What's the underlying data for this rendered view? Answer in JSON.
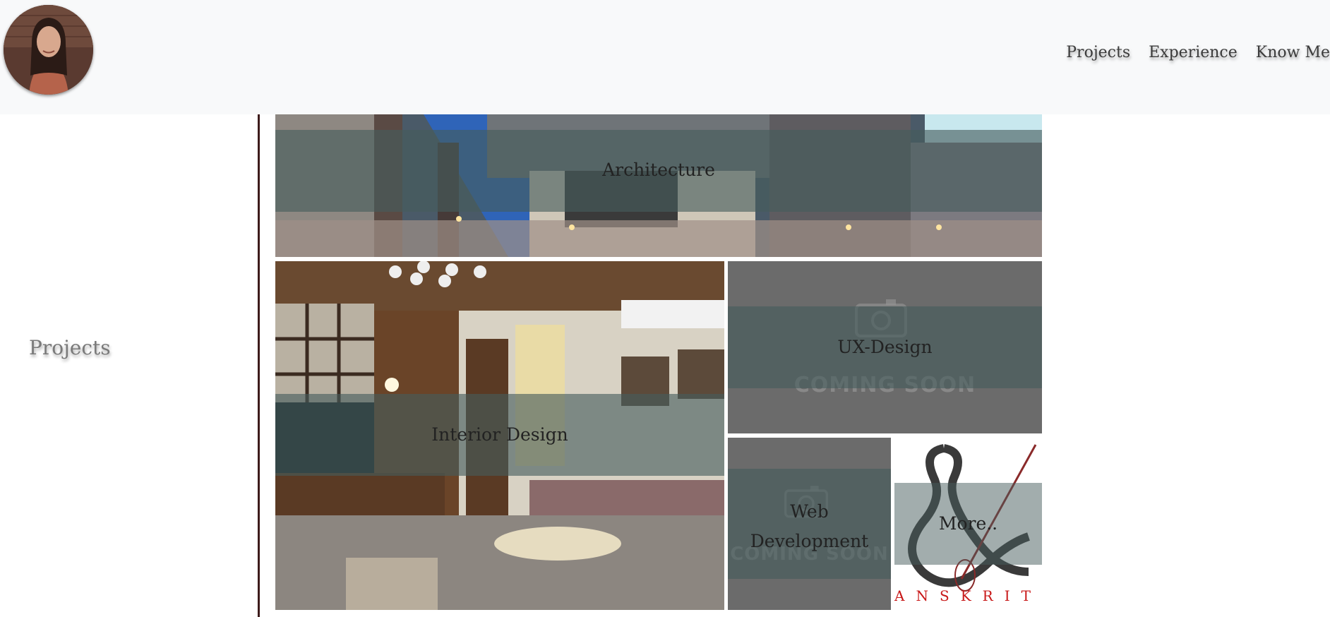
{
  "header": {
    "nav": {
      "projects": "Projects",
      "experience": "Experience",
      "know_me": "Know Me"
    }
  },
  "sidebar": {
    "section_title": "Projects"
  },
  "tiles": {
    "architecture": "Architecture",
    "interior": "Interior Design",
    "ux": "UX-Design",
    "web_line1": "Web",
    "web_line2": "Development",
    "more": "More..",
    "coming_soon": "COMING SOON",
    "sanskrit_text": "ANSKRIT"
  },
  "colors": {
    "header_bg": "#f8f9fa",
    "divider": "#3d1b1b",
    "overlay": "#465c5c",
    "nav_text": "#3b3b3b"
  }
}
